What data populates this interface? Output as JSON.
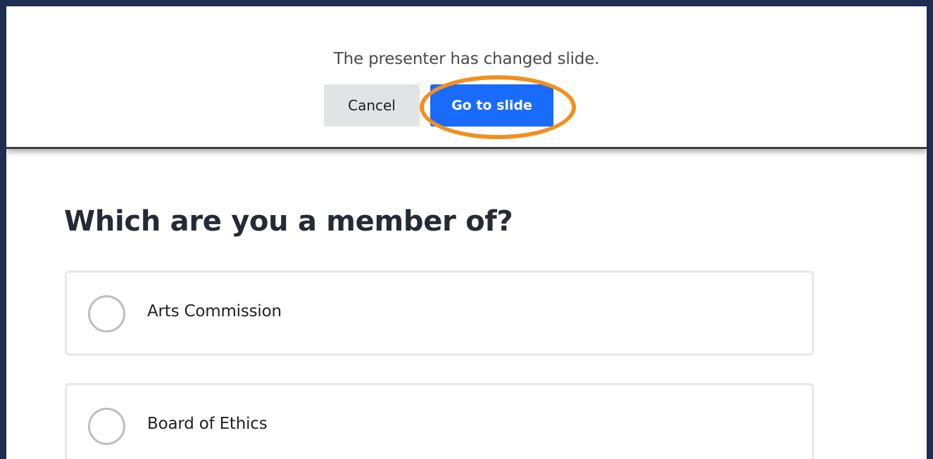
{
  "banner": {
    "message": "The presenter has changed slide.",
    "cancel_label": "Cancel",
    "go_label": "Go to slide",
    "highlight_color": "#f1901f"
  },
  "poll": {
    "question": "Which are you a member of?",
    "options": [
      {
        "label": "Arts Commission",
        "selected": false
      },
      {
        "label": "Board of Ethics",
        "selected": false
      }
    ]
  },
  "colors": {
    "frame_border": "#1d2e52",
    "primary_button": "#196cfb",
    "secondary_button": "#e2e3e5",
    "annotation_ring": "#f1901f"
  }
}
